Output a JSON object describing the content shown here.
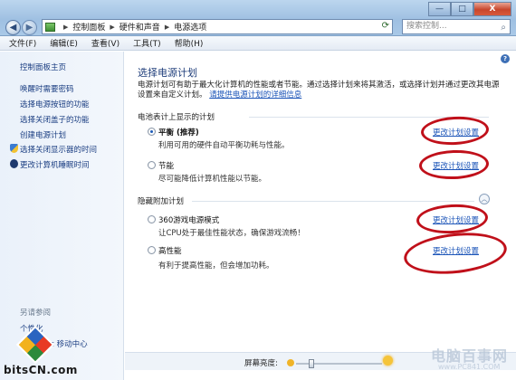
{
  "window": {
    "breadcrumb": [
      "控制面板",
      "硬件和声音",
      "电源选项"
    ],
    "search_placeholder": "搜索控制...",
    "min_label": "—",
    "max_label": "□",
    "close_label": "X"
  },
  "menu": [
    "文件(F)",
    "编辑(E)",
    "查看(V)",
    "工具(T)",
    "帮助(H)"
  ],
  "sidebar": {
    "home": "控制面板主页",
    "items": [
      "唤醒时需要密码",
      "选择电源按钮的功能",
      "选择关闭盖子的功能",
      "创建电源计划",
      "选择关闭显示器的时间",
      "更改计算机睡眠时间"
    ],
    "see_also": "另请参阅",
    "bottom": [
      "个性化",
      "Windows 移动中心"
    ]
  },
  "main": {
    "title": "选择电源计划",
    "description": "电源计划可有助于最大化计算机的性能或者节能。通过选择计划来将其激活，或选择计划并通过更改其电源设置来自定义计划。",
    "learn_more": "请提供电源计划的详细信息",
    "battery_section": "电池表计上显示的计划",
    "hidden_section": "隐藏附加计划",
    "change_link": "更改计划设置",
    "plans": [
      {
        "name": "平衡 (推荐)",
        "desc": "利用可用的硬件自动平衡功耗与性能。",
        "selected": true
      },
      {
        "name": "节能",
        "desc": "尽可能降低计算机性能以节能。",
        "selected": false
      },
      {
        "name": "360游戏电源模式",
        "desc": "让CPU处于最佳性能状态，确保游戏流畅！",
        "selected": false
      },
      {
        "name": "高性能",
        "desc": "有利于提高性能，但会增加功耗。",
        "selected": false
      }
    ],
    "brightness_label": "屏幕亮度:"
  },
  "watermarks": {
    "left": "bitsCN.com",
    "right_cn": "电脑百事网",
    "right_url": "www.PC841.COM"
  },
  "colors": {
    "annotation_ring": "#c0101a",
    "link": "#1b54b8"
  }
}
